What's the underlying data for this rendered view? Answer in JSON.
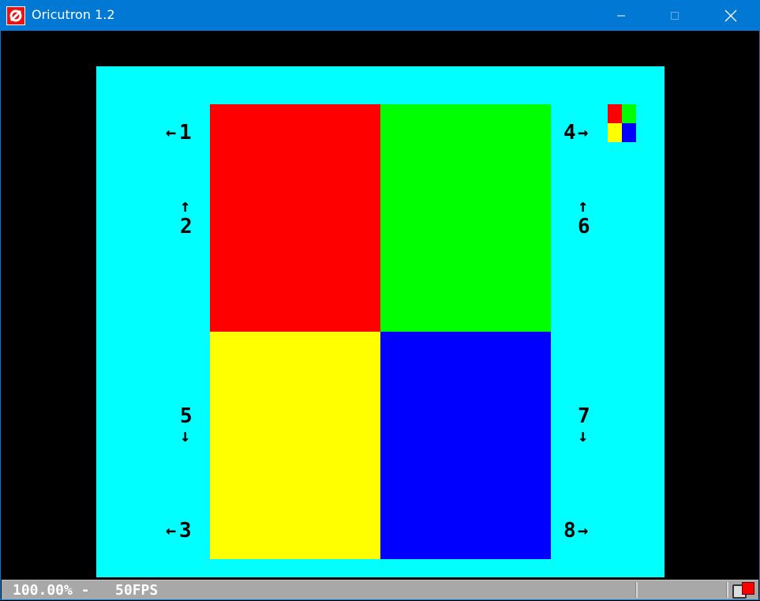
{
  "window": {
    "title": "Oricutron 1.2",
    "controls": {
      "minimize": "minimize",
      "maximize": "maximize",
      "close": "close"
    }
  },
  "screen": {
    "background": "#00ffff",
    "quadrants": [
      {
        "name": "red",
        "color": "#ff0000"
      },
      {
        "name": "green",
        "color": "#00ff00"
      },
      {
        "name": "yellow",
        "color": "#ffff00"
      },
      {
        "name": "blue",
        "color": "#0000ff"
      }
    ],
    "labels": {
      "l1": "1",
      "l2": "2",
      "l3": "3",
      "l4": "4",
      "l5": "5",
      "l6": "6",
      "l7": "7",
      "l8": "8"
    },
    "arrows": {
      "left": "←",
      "right": "→",
      "up": "↑",
      "down": "↓"
    }
  },
  "statusbar": {
    "text": "100.00% -   50FPS",
    "led_color": "#ff0000"
  }
}
